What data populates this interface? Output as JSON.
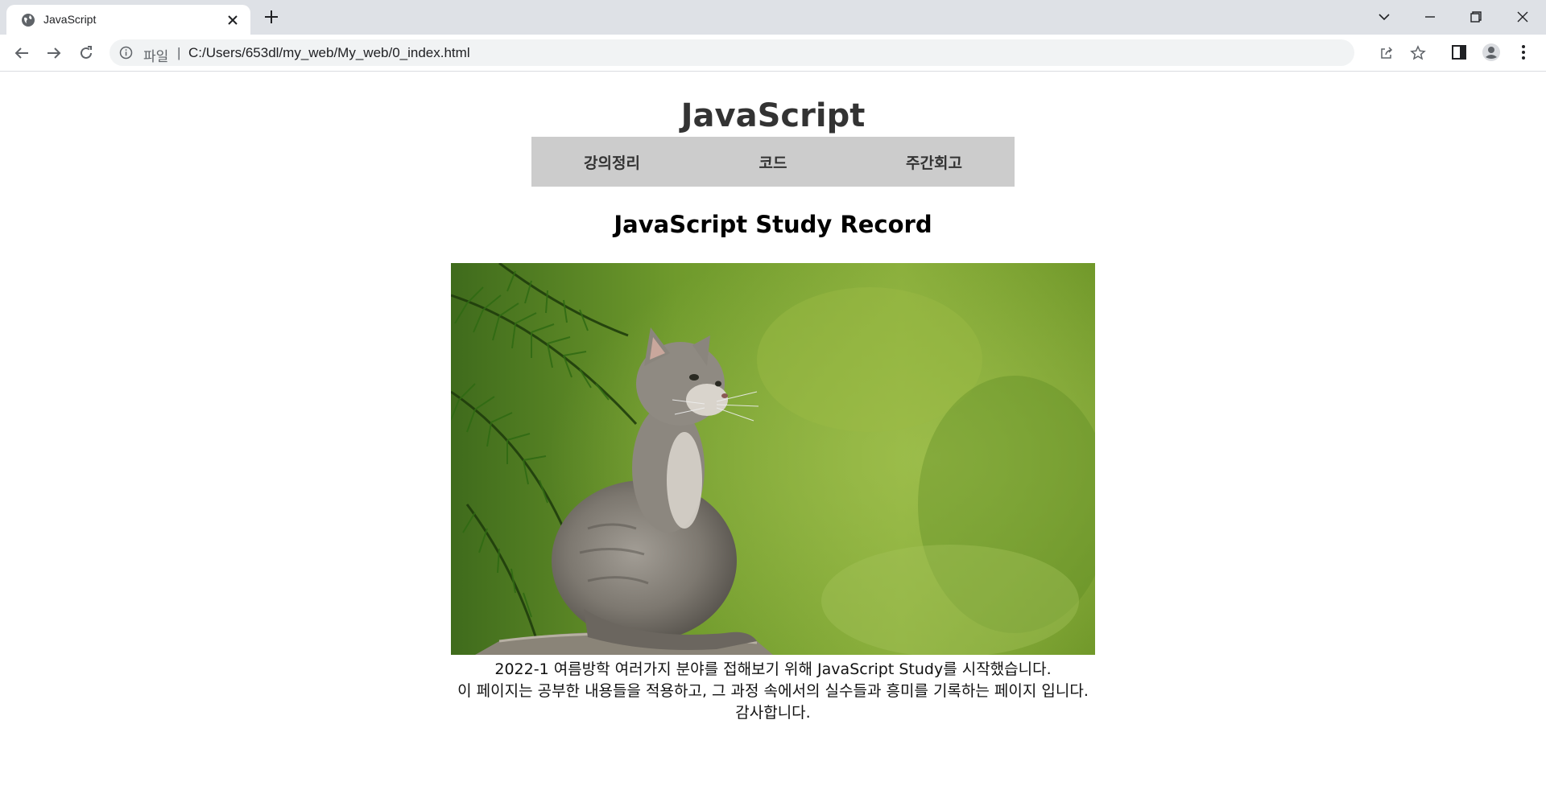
{
  "browser": {
    "tab_title": "JavaScript",
    "address_scheme": "파일",
    "address_separator": "|",
    "address_url": "C:/Users/653dl/my_web/My_web/0_index.html"
  },
  "site": {
    "title": "JavaScript",
    "nav": [
      {
        "label": "강의정리"
      },
      {
        "label": "코드"
      },
      {
        "label": "주간회고"
      }
    ],
    "heading": "JavaScript Study Record",
    "image": "kitten-photo",
    "intro_lines": [
      "2022-1 여름방학 여러가지 분야를 접해보기 위해 JavaScript Study를 시작했습니다.",
      "이 페이지는 공부한 내용들을 적용하고, 그 과정 속에서의 실수들과 흥미를 기록하는 페이지 입니다.",
      "감사합니다."
    ]
  },
  "colors": {
    "tabstrip": "#dee1e6",
    "nav_background": "#cccccc",
    "title_text": "#333333"
  }
}
